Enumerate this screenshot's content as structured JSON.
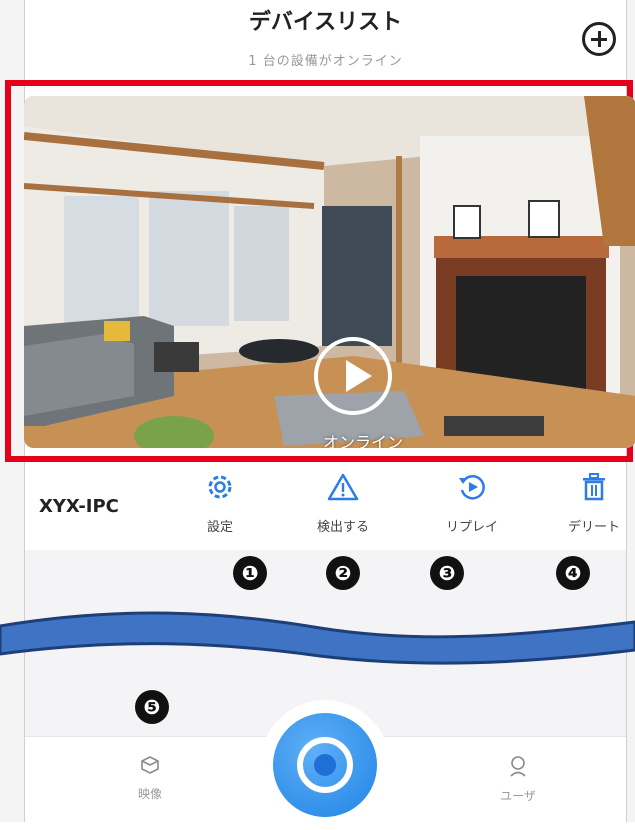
{
  "header": {
    "title": "デバイスリスト",
    "subtitle": "1 台の設備がオンライン",
    "add_icon": "plus-circle-icon"
  },
  "preview": {
    "status_label": "オンライン",
    "play_icon": "play-icon"
  },
  "device": {
    "name": "XYX-IPC",
    "actions": [
      {
        "label": "設定",
        "icon": "gear-icon",
        "marker": "❶"
      },
      {
        "label": "検出する",
        "icon": "warning-icon",
        "marker": "❷"
      },
      {
        "label": "リプレイ",
        "icon": "replay-icon",
        "marker": "❸"
      },
      {
        "label": "デリート",
        "icon": "trash-icon",
        "marker": "❹"
      }
    ]
  },
  "tabbar": {
    "video_marker": "❺",
    "tabs": [
      {
        "label": "映像",
        "icon": "cube-icon"
      },
      {
        "label": "ユーザ",
        "icon": "user-icon"
      }
    ],
    "center_icon": "eye-icon"
  },
  "colors": {
    "accent": "#2b7de9",
    "highlight": "#e4001b",
    "wave": "#3f74c4"
  }
}
